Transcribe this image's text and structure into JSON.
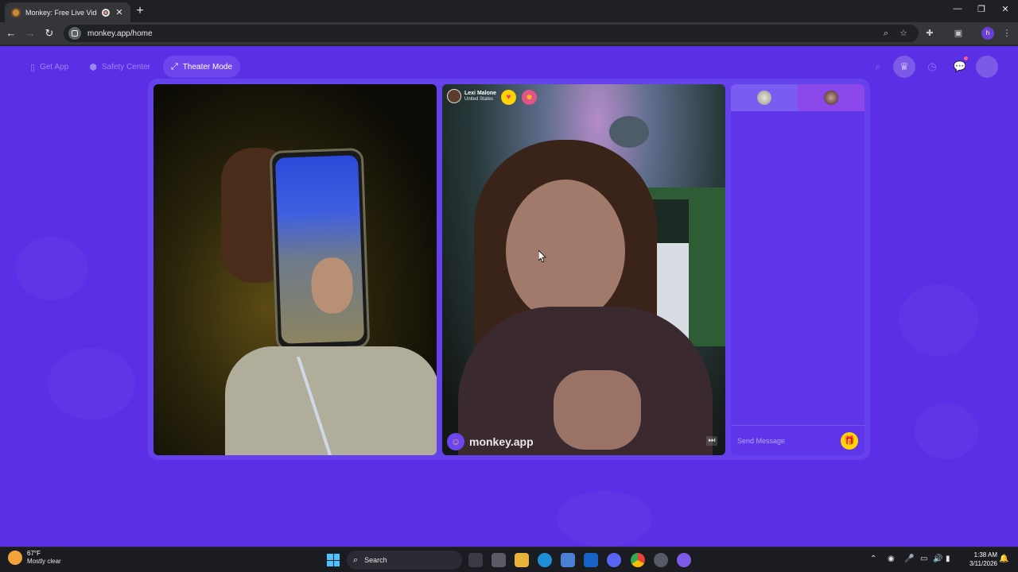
{
  "browser": {
    "tab_title": "Monkey: Free Live Video Chat",
    "new_tab_label": "+",
    "url": "monkey.app/home",
    "window_controls": {
      "minimize": "—",
      "restore": "❐",
      "close": "✕"
    }
  },
  "topnav": {
    "get_app": "Get App",
    "safety_center": "Safety Center",
    "theater_mode": "Theater Mode"
  },
  "remote_user": {
    "name": "Lexi Malone",
    "country": "United States"
  },
  "watermark": "monkey.app",
  "chat": {
    "placeholder": "Send Message"
  },
  "taskbar": {
    "weather_temp": "67°F",
    "weather_desc": "Mostly clear",
    "search_label": "Search",
    "time": "1:38 AM",
    "date": "3/11/2026"
  },
  "colors": {
    "page_bg": "#5a2fe6",
    "accent_yellow": "#ffd400",
    "chrome_bg": "#35363a"
  },
  "icons": [
    "monkey-favicon",
    "recording-icon",
    "back-arrow-icon",
    "forward-arrow-icon",
    "reload-icon",
    "zoom-icon",
    "star-icon",
    "extensions-icon",
    "sidepanel-icon",
    "phone-icon",
    "shield-icon",
    "expand-icon",
    "search-icon",
    "crown-icon",
    "history-icon",
    "chat-icon",
    "heart-icon",
    "gift-icon",
    "skip-icon"
  ]
}
